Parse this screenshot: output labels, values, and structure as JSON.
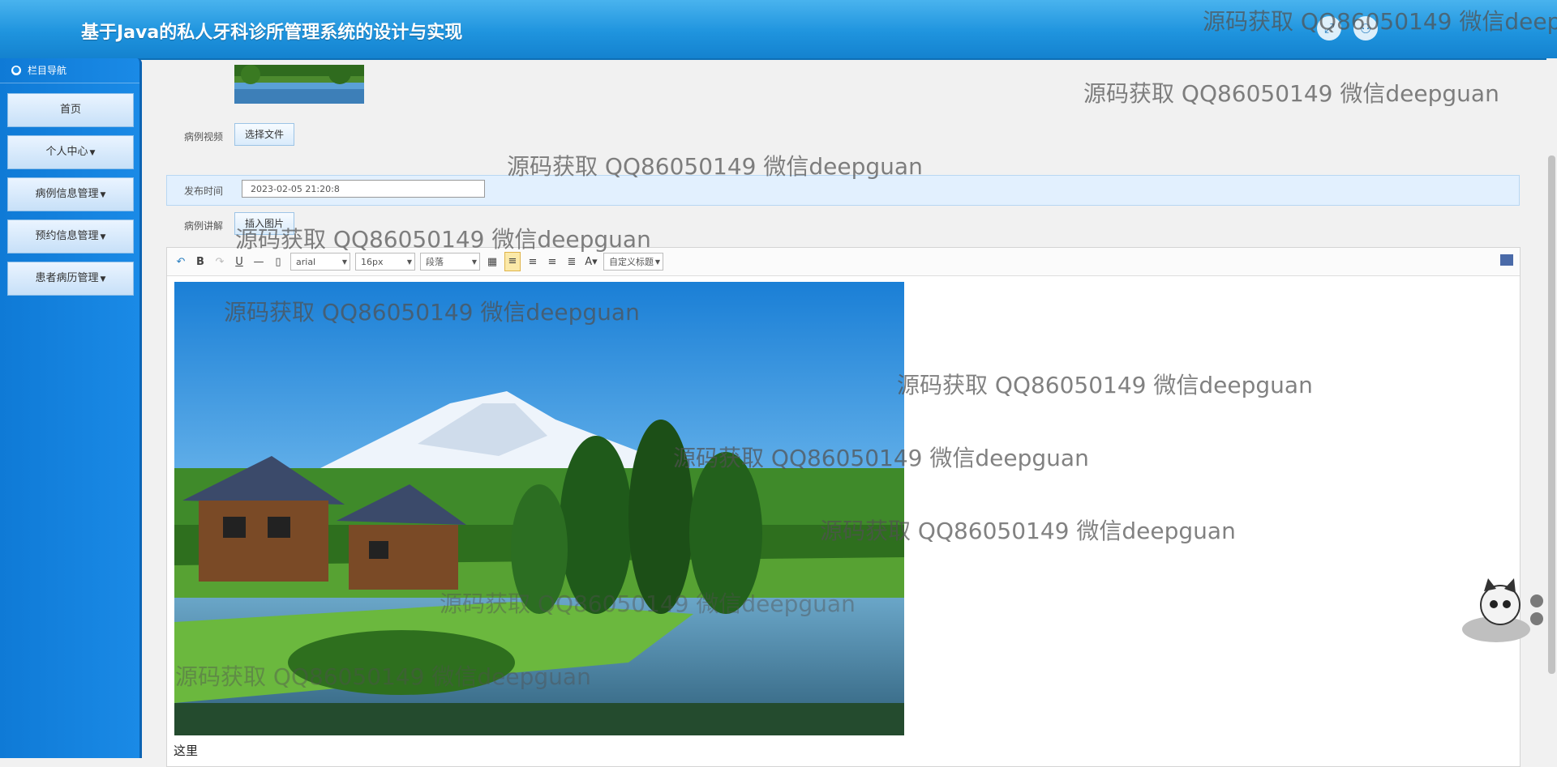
{
  "header": {
    "title": "基于Java的私人牙科诊所管理系统的设计与实现",
    "buttons": [
      {
        "icon": "fullscreen-icon"
      },
      {
        "icon": "user-icon"
      }
    ]
  },
  "sidebar": {
    "heading": "栏目导航",
    "items": [
      {
        "label": "首页",
        "has_dropdown": false
      },
      {
        "label": "个人中心",
        "has_dropdown": true
      },
      {
        "label": "病例信息管理",
        "has_dropdown": true
      },
      {
        "label": "预约信息管理",
        "has_dropdown": true
      },
      {
        "label": "患者病历管理",
        "has_dropdown": true
      }
    ]
  },
  "form": {
    "video_label": "病例视频",
    "choose_file": "选择文件",
    "publish_time_label": "发布时间",
    "publish_time_value": "2023-02-05 21:20:8",
    "explain_label": "病例讲解",
    "insert_image": "插入图片"
  },
  "editor": {
    "font_family": "arial",
    "font_size": "16px",
    "paragraph": "段落",
    "custom_heading": "自定义标题",
    "body_text": "这里"
  },
  "watermark_text": "源码获取 QQ86050149 微信deepguan"
}
